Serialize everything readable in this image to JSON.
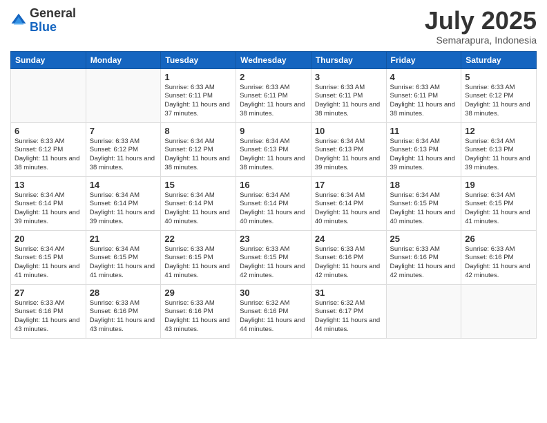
{
  "header": {
    "logo_general": "General",
    "logo_blue": "Blue",
    "month_title": "July 2025",
    "subtitle": "Semarapura, Indonesia"
  },
  "days_of_week": [
    "Sunday",
    "Monday",
    "Tuesday",
    "Wednesday",
    "Thursday",
    "Friday",
    "Saturday"
  ],
  "weeks": [
    [
      {
        "day": "",
        "info": ""
      },
      {
        "day": "",
        "info": ""
      },
      {
        "day": "1",
        "sunrise": "6:33 AM",
        "sunset": "6:11 PM",
        "daylight": "11 hours and 37 minutes."
      },
      {
        "day": "2",
        "sunrise": "6:33 AM",
        "sunset": "6:11 PM",
        "daylight": "11 hours and 38 minutes."
      },
      {
        "day": "3",
        "sunrise": "6:33 AM",
        "sunset": "6:11 PM",
        "daylight": "11 hours and 38 minutes."
      },
      {
        "day": "4",
        "sunrise": "6:33 AM",
        "sunset": "6:11 PM",
        "daylight": "11 hours and 38 minutes."
      },
      {
        "day": "5",
        "sunrise": "6:33 AM",
        "sunset": "6:12 PM",
        "daylight": "11 hours and 38 minutes."
      }
    ],
    [
      {
        "day": "6",
        "sunrise": "6:33 AM",
        "sunset": "6:12 PM",
        "daylight": "11 hours and 38 minutes."
      },
      {
        "day": "7",
        "sunrise": "6:33 AM",
        "sunset": "6:12 PM",
        "daylight": "11 hours and 38 minutes."
      },
      {
        "day": "8",
        "sunrise": "6:34 AM",
        "sunset": "6:12 PM",
        "daylight": "11 hours and 38 minutes."
      },
      {
        "day": "9",
        "sunrise": "6:34 AM",
        "sunset": "6:13 PM",
        "daylight": "11 hours and 38 minutes."
      },
      {
        "day": "10",
        "sunrise": "6:34 AM",
        "sunset": "6:13 PM",
        "daylight": "11 hours and 39 minutes."
      },
      {
        "day": "11",
        "sunrise": "6:34 AM",
        "sunset": "6:13 PM",
        "daylight": "11 hours and 39 minutes."
      },
      {
        "day": "12",
        "sunrise": "6:34 AM",
        "sunset": "6:13 PM",
        "daylight": "11 hours and 39 minutes."
      }
    ],
    [
      {
        "day": "13",
        "sunrise": "6:34 AM",
        "sunset": "6:14 PM",
        "daylight": "11 hours and 39 minutes."
      },
      {
        "day": "14",
        "sunrise": "6:34 AM",
        "sunset": "6:14 PM",
        "daylight": "11 hours and 39 minutes."
      },
      {
        "day": "15",
        "sunrise": "6:34 AM",
        "sunset": "6:14 PM",
        "daylight": "11 hours and 40 minutes."
      },
      {
        "day": "16",
        "sunrise": "6:34 AM",
        "sunset": "6:14 PM",
        "daylight": "11 hours and 40 minutes."
      },
      {
        "day": "17",
        "sunrise": "6:34 AM",
        "sunset": "6:14 PM",
        "daylight": "11 hours and 40 minutes."
      },
      {
        "day": "18",
        "sunrise": "6:34 AM",
        "sunset": "6:15 PM",
        "daylight": "11 hours and 40 minutes."
      },
      {
        "day": "19",
        "sunrise": "6:34 AM",
        "sunset": "6:15 PM",
        "daylight": "11 hours and 41 minutes."
      }
    ],
    [
      {
        "day": "20",
        "sunrise": "6:34 AM",
        "sunset": "6:15 PM",
        "daylight": "11 hours and 41 minutes."
      },
      {
        "day": "21",
        "sunrise": "6:34 AM",
        "sunset": "6:15 PM",
        "daylight": "11 hours and 41 minutes."
      },
      {
        "day": "22",
        "sunrise": "6:33 AM",
        "sunset": "6:15 PM",
        "daylight": "11 hours and 41 minutes."
      },
      {
        "day": "23",
        "sunrise": "6:33 AM",
        "sunset": "6:15 PM",
        "daylight": "11 hours and 42 minutes."
      },
      {
        "day": "24",
        "sunrise": "6:33 AM",
        "sunset": "6:16 PM",
        "daylight": "11 hours and 42 minutes."
      },
      {
        "day": "25",
        "sunrise": "6:33 AM",
        "sunset": "6:16 PM",
        "daylight": "11 hours and 42 minutes."
      },
      {
        "day": "26",
        "sunrise": "6:33 AM",
        "sunset": "6:16 PM",
        "daylight": "11 hours and 42 minutes."
      }
    ],
    [
      {
        "day": "27",
        "sunrise": "6:33 AM",
        "sunset": "6:16 PM",
        "daylight": "11 hours and 43 minutes."
      },
      {
        "day": "28",
        "sunrise": "6:33 AM",
        "sunset": "6:16 PM",
        "daylight": "11 hours and 43 minutes."
      },
      {
        "day": "29",
        "sunrise": "6:33 AM",
        "sunset": "6:16 PM",
        "daylight": "11 hours and 43 minutes."
      },
      {
        "day": "30",
        "sunrise": "6:32 AM",
        "sunset": "6:16 PM",
        "daylight": "11 hours and 44 minutes."
      },
      {
        "day": "31",
        "sunrise": "6:32 AM",
        "sunset": "6:17 PM",
        "daylight": "11 hours and 44 minutes."
      },
      {
        "day": "",
        "info": ""
      },
      {
        "day": "",
        "info": ""
      }
    ]
  ]
}
